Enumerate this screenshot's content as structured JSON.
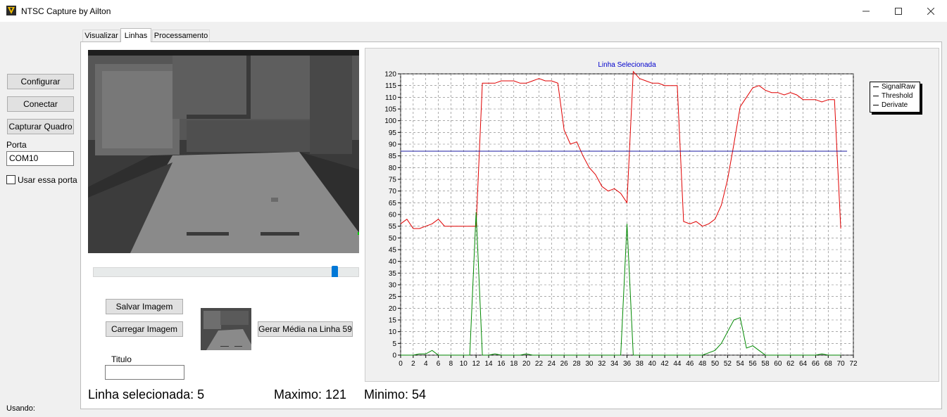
{
  "window": {
    "title": "NTSC Capture by Ailton"
  },
  "left_panel": {
    "configure_label": "Configurar",
    "connect_label": "Conectar",
    "capture_label": "Capturar Quadro",
    "port_label": "Porta",
    "port_value": "COM10",
    "use_port_label": "Usar essa porta",
    "using_label": "Usando:"
  },
  "tabs": [
    {
      "label": "Visualizar",
      "active": false
    },
    {
      "label": "Linhas",
      "active": true
    },
    {
      "label": "Processamento",
      "active": false
    }
  ],
  "image_tools": {
    "slider_value_fraction": 0.9,
    "save_image_label": "Salvar Imagem",
    "load_image_label": "Carregar Imagem",
    "average_button_label": "Gerar Média na Linha 59",
    "title_label": "Titulo",
    "title_value": ""
  },
  "stats": {
    "selected_line": "Linha selecionada: 5",
    "maximum": "Maximo: 121",
    "minimum": "Minimo: 54"
  },
  "legend": {
    "items": [
      "SignalRaw",
      "Threshold",
      "Derivate"
    ]
  },
  "colors": {
    "signal_raw": "#e00000",
    "threshold": "#1a1aa0",
    "derivate": "#008800",
    "title": "#0000cc"
  },
  "chart_data": {
    "type": "line",
    "title": "Linha Selecionada",
    "xlim": [
      0,
      72
    ],
    "ylim": [
      0,
      120
    ],
    "x_ticks": [
      0,
      2,
      4,
      6,
      8,
      10,
      12,
      14,
      16,
      18,
      20,
      22,
      24,
      26,
      28,
      30,
      32,
      34,
      36,
      38,
      40,
      42,
      44,
      46,
      48,
      50,
      52,
      54,
      56,
      58,
      60,
      62,
      64,
      66,
      68,
      70,
      72
    ],
    "y_ticks": [
      0,
      5,
      10,
      15,
      20,
      25,
      30,
      35,
      40,
      45,
      50,
      55,
      60,
      65,
      70,
      75,
      80,
      85,
      90,
      95,
      100,
      105,
      110,
      115,
      120
    ],
    "grid": true,
    "legend_position": "right",
    "series": [
      {
        "name": "SignalRaw",
        "x": [
          0,
          1,
          2,
          3,
          4,
          5,
          6,
          7,
          8,
          9,
          10,
          11,
          12,
          13,
          14,
          15,
          16,
          17,
          18,
          19,
          20,
          21,
          22,
          23,
          24,
          25,
          26,
          27,
          28,
          29,
          30,
          31,
          32,
          33,
          34,
          35,
          36,
          37,
          38,
          39,
          40,
          41,
          42,
          43,
          44,
          45,
          46,
          47,
          48,
          49,
          50,
          51,
          52,
          53,
          54,
          55,
          56,
          57,
          58,
          59,
          60,
          61,
          62,
          63,
          64,
          65,
          66,
          67,
          68,
          69,
          70,
          71
        ],
        "y": [
          56,
          58,
          54,
          54,
          55,
          56,
          58,
          55,
          55,
          55,
          55,
          55,
          55,
          116,
          116,
          116,
          117,
          117,
          117,
          116,
          116,
          117,
          118,
          117,
          117,
          116,
          96,
          90,
          91,
          85,
          80,
          77,
          72,
          70,
          71,
          69,
          65,
          121,
          118,
          117,
          116,
          116,
          115,
          115,
          115,
          57,
          56,
          57,
          55,
          56,
          58,
          64,
          75,
          90,
          106,
          110,
          114,
          115,
          113,
          112,
          112,
          111,
          112,
          111,
          109,
          109,
          109,
          108,
          109,
          109,
          54,
          null
        ],
        "color_ref": "signal_raw"
      },
      {
        "name": "Threshold",
        "x": [
          0,
          71
        ],
        "y": [
          87,
          87
        ],
        "color_ref": "threshold"
      },
      {
        "name": "Derivate",
        "x": [
          0,
          1,
          2,
          3,
          4,
          5,
          6,
          7,
          8,
          9,
          10,
          11,
          12,
          13,
          14,
          15,
          16,
          17,
          18,
          19,
          20,
          21,
          22,
          23,
          24,
          25,
          26,
          27,
          28,
          29,
          30,
          31,
          32,
          33,
          34,
          35,
          36,
          37,
          38,
          39,
          40,
          41,
          42,
          43,
          44,
          45,
          46,
          47,
          48,
          49,
          50,
          51,
          52,
          53,
          54,
          55,
          56,
          57,
          58,
          59,
          60,
          61,
          62,
          63,
          64,
          65,
          66,
          67,
          68,
          69,
          70
        ],
        "y": [
          0,
          0,
          0,
          0.5,
          0.5,
          2,
          0,
          0,
          0,
          0,
          0,
          0,
          61,
          0,
          0,
          0.5,
          0,
          0,
          0,
          0,
          0.5,
          0,
          0,
          0,
          0,
          0,
          0,
          0,
          0,
          0,
          0,
          0,
          0,
          0,
          0,
          0,
          56,
          0,
          0,
          0,
          0,
          0,
          0,
          0,
          0,
          0,
          0,
          0,
          0,
          1,
          2,
          5,
          10,
          15,
          16,
          3,
          4,
          2,
          0,
          0,
          0,
          0,
          0,
          0,
          0,
          0,
          0,
          0.5,
          0,
          0,
          0
        ],
        "color_ref": "derivate"
      }
    ]
  }
}
